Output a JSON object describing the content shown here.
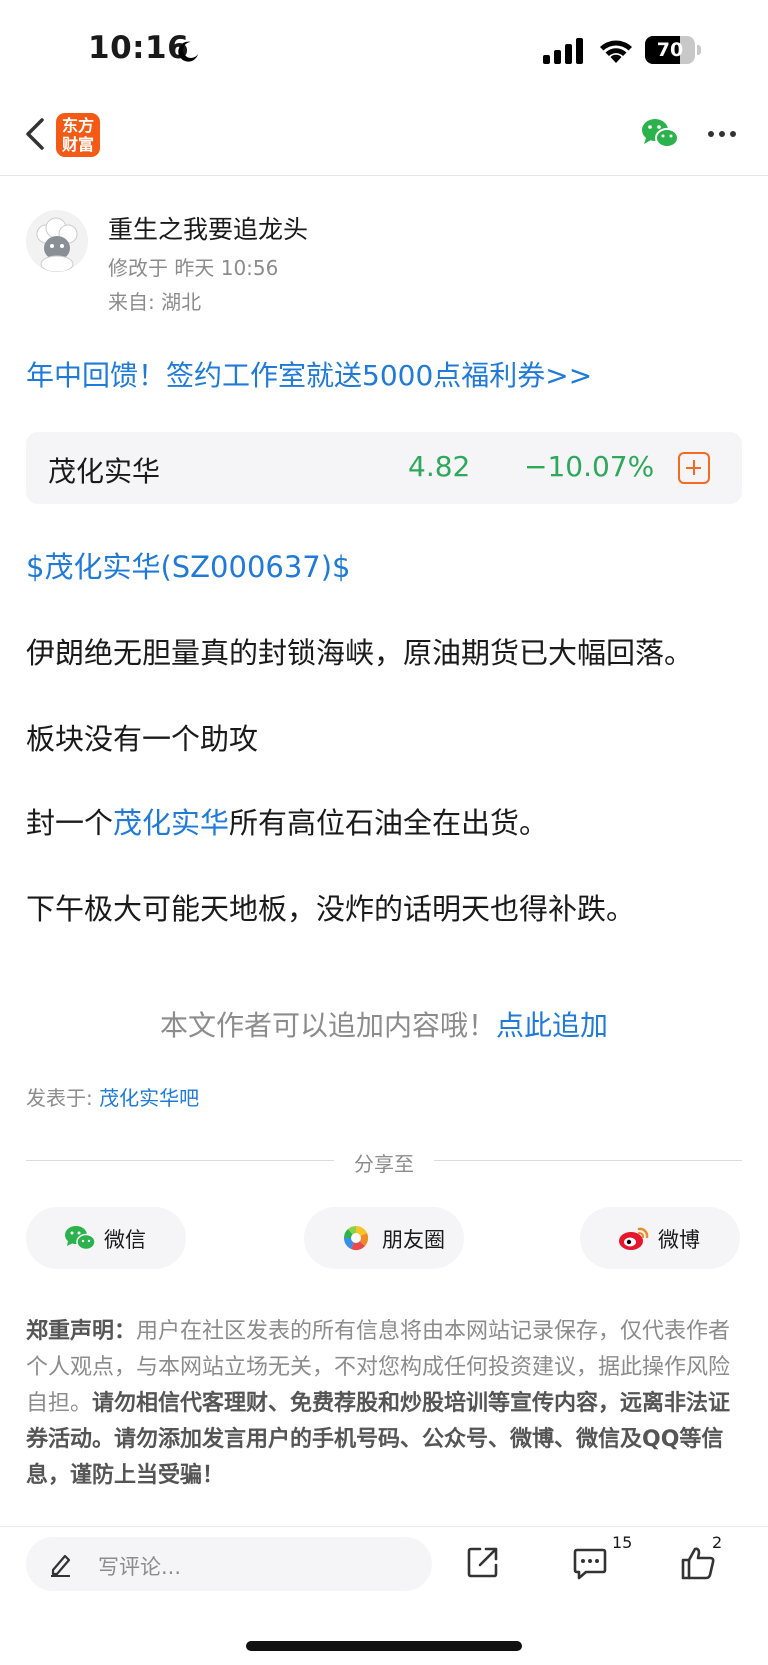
{
  "status_bar": {
    "time": "10:16",
    "battery": "70",
    "battery_level": 0.7
  },
  "nav": {
    "logo_text_line1": "东方",
    "logo_text_line2": "财富",
    "brand_color": "#f25a16"
  },
  "author": {
    "name": "重生之我要追龙头",
    "modified": "修改于  昨天 10:56",
    "location": "来自: 湖北"
  },
  "promo": {
    "text": "年中回馈！签约工作室就送5000点福利券>>"
  },
  "stock": {
    "name": "茂化实华",
    "price": "4.82",
    "change": "−10.07%",
    "change_color": "#2ea85a"
  },
  "post": {
    "stock_tag": "$茂化实华(SZ000637)$",
    "p1": "伊朗绝无胆量真的封锁海峡，原油期货已大幅回落。",
    "p2": "板块没有一个助攻",
    "p3_before": "封一个",
    "p3_link": "茂化实华",
    "p3_after": "所有高位石油全在出货。",
    "p4": "下午极大可能天地板，没炸的话明天也得补跌。"
  },
  "append": {
    "text": "本文作者可以追加内容哦！",
    "link": "点此追加"
  },
  "posted_in": {
    "label": "发表于: ",
    "board": "茂化实华吧"
  },
  "share": {
    "title": "分享至",
    "wechat": "微信",
    "moments": "朋友圈",
    "weibo": "微博"
  },
  "disclaimer": {
    "title": "郑重声明：",
    "normal": "用户在社区发表的所有信息将由本网站记录保存，仅代表作者个人观点，与本网站立场无关，不对您构成任何投资建议，据此操作风险自担。",
    "bold": "请勿相信代客理财、免费荐股和炒股培训等宣传内容，远离非法证券活动。请勿添加发言用户的手机号码、公众号、微博、微信及QQ等信息，谨防上当受骗！"
  },
  "bottom_bar": {
    "comment_placeholder": "写评论...",
    "comment_count": "15",
    "like_count": "2"
  },
  "colors": {
    "link": "#1f7ad8",
    "down": "#2ea85a",
    "accent": "#f26b21"
  }
}
